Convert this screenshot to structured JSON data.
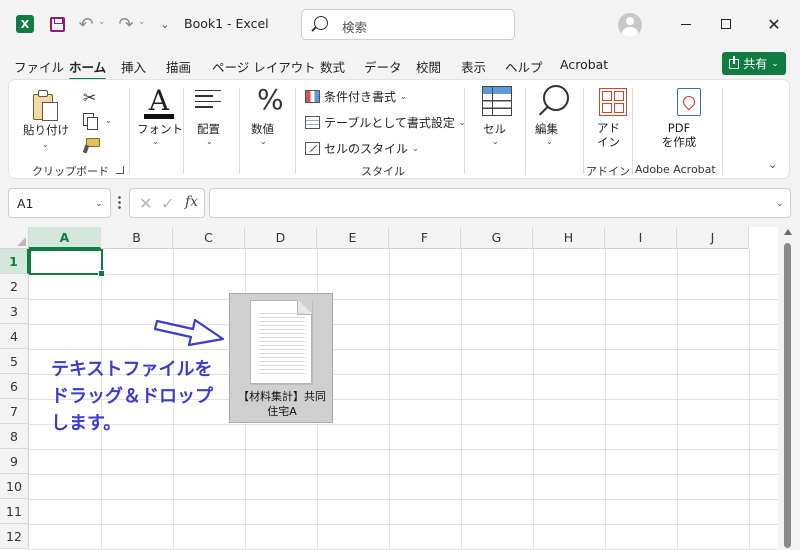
{
  "titlebar": {
    "doc_title": "Book1  -  Excel",
    "search_placeholder": "検索"
  },
  "menu": {
    "tabs": [
      "ファイル",
      "ホーム",
      "挿入",
      "描画",
      "ページ レイアウト",
      "数式",
      "データ",
      "校閲",
      "表示",
      "ヘルプ",
      "Acrobat"
    ],
    "active_tab": "ホーム",
    "share_label": "共有"
  },
  "ribbon": {
    "paste_label": "貼り付け",
    "clipboard_group": "クリップボード",
    "font_label": "フォント",
    "align_label": "配置",
    "number_label": "数値",
    "conditional_format": "条件付き書式",
    "format_as_table": "テーブルとして書式設定",
    "cell_styles": "セルのスタイル",
    "styles_group": "スタイル",
    "cells_label": "セル",
    "edit_label": "編集",
    "addins_label": "アド\nイン",
    "addins_group": "アドイン",
    "pdf_label": "PDF\nを作成",
    "acrobat_group": "Adobe Acrobat"
  },
  "formula_bar": {
    "name_box": "A1",
    "fx": "fx",
    "formula": ""
  },
  "sheet": {
    "columns": [
      "A",
      "B",
      "C",
      "D",
      "E",
      "F",
      "G",
      "H",
      "I",
      "J"
    ],
    "rows": [
      "1",
      "2",
      "3",
      "4",
      "5",
      "6",
      "7",
      "8",
      "9",
      "10",
      "11",
      "12"
    ],
    "selected_cell": "A1"
  },
  "drag_file": {
    "name": "【材料集計】共同\n住宅A"
  },
  "annotation": {
    "text": "テキストファイルを\nドラッグ＆ドロップ\nします。",
    "color": "#3b3bd1"
  },
  "colors": {
    "accent": "#107c41"
  }
}
